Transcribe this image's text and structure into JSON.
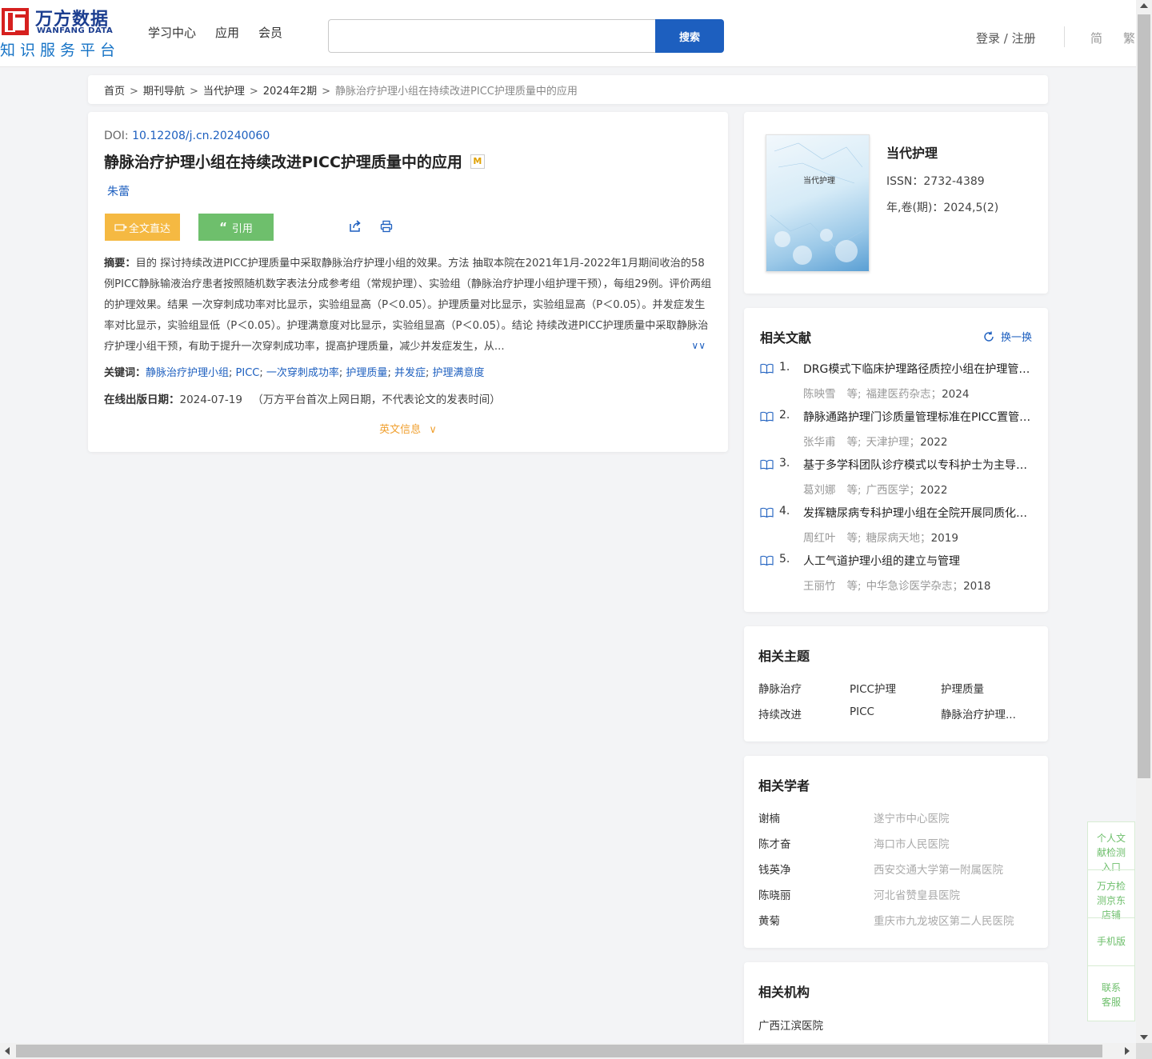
{
  "header": {
    "logo_cn": "万方数据",
    "logo_en": "WANFANG DATA",
    "logo_sub": "知识服务平台",
    "nav": [
      "学习中心",
      "应用",
      "会员"
    ],
    "search_placeholder": "",
    "search_button": "搜索",
    "login": "登录 / 注册",
    "lang_simplified": "简",
    "lang_traditional": "繁"
  },
  "breadcrumb": [
    "首页",
    "期刊导航",
    "当代护理",
    "2024年2期",
    "静脉治疗护理小组在持续改进PICC护理质量中的应用"
  ],
  "article": {
    "doi_label": "DOI:",
    "doi": "10.12208/j.cn.20240060",
    "title": "静脉治疗护理小组在持续改进PICC护理质量中的应用",
    "title_badge": "M",
    "author": "朱蕾",
    "btn_fulltext": "全文直达",
    "btn_cite": "引用",
    "abstract_label": "摘要：",
    "abstract": "目的 探讨持续改进PICC护理质量中采取静脉治疗护理小组的效果。方法 抽取本院在2021年1月-2022年1月期间收治的58例PICC静脉输液治疗患者按照随机数字表法分成参考组（常规护理）、实验组（静脉治疗护理小组护理干预），每组29例。评价两组的护理效果。结果 一次穿刺成功率对比显示，实验组显高（P＜0.05）。护理质量对比显示，实验组显高（P＜0.05）。并发症发生率对比显示，实验组显低（P＜0.05）。护理满意度对比显示，实验组显高（P＜0.05）。结论 持续改进PICC护理质量中采取静脉治疗护理小组干预，有助于提升一次穿刺成功率，提高护理质量，减少并发症发生，从...",
    "keywords_label": "关键词：",
    "keywords": [
      "静脉治疗护理小组",
      "PICC",
      "一次穿刺成功率",
      "护理质量",
      "并发症",
      "护理满意度"
    ],
    "pubdate_label": "在线出版日期：",
    "pubdate": "2024-07-19",
    "pubdate_note": "（万方平台首次上网日期，不代表论文的发表时间）",
    "english_info": "英文信息"
  },
  "journal": {
    "cover_title": "当代护理",
    "name": "当代护理",
    "issn": "ISSN：2732-4389",
    "volume": "年,卷(期)：2024,5(2)"
  },
  "related_docs": {
    "title": "相关文献",
    "refresh": "换一换",
    "items": [
      {
        "num": "1.",
        "title": "DRG模式下临床护理路径质控小组在护理管理中的应用",
        "author": "陈映雪",
        "etal": "等;",
        "source": "福建医药杂志；",
        "year": "2024"
      },
      {
        "num": "2.",
        "title": "静脉通路护理门诊质量管理标准在PICC置管患者中的应用",
        "author": "张华甫",
        "etal": "等;",
        "source": "天津护理；",
        "year": "2022"
      },
      {
        "num": "3.",
        "title": "基于多学科团队诊疗模式以专科护士为主导的管理实践",
        "author": "葛刘娜",
        "etal": "等;",
        "source": "广西医学；",
        "year": "2022"
      },
      {
        "num": "4.",
        "title": "发挥糖尿病专科护理小组在全院开展同质化护理中的作用",
        "author": "周红叶",
        "etal": "等;",
        "source": "糖尿病天地；",
        "year": "2019"
      },
      {
        "num": "5.",
        "title": "人工气道护理小组的建立与管理",
        "author": "王丽竹",
        "etal": "等;",
        "source": "中华急诊医学杂志；",
        "year": "2018"
      }
    ]
  },
  "related_topics": {
    "title": "相关主题",
    "items": [
      "静脉治疗",
      "PICC护理",
      "护理质量",
      "持续改进",
      "PICC",
      "静脉治疗护理..."
    ]
  },
  "related_scholars": {
    "title": "相关学者",
    "items": [
      {
        "name": "谢楠",
        "org": "遂宁市中心医院"
      },
      {
        "name": "陈才奋",
        "org": "海口市人民医院"
      },
      {
        "name": "钱英净",
        "org": "西安交通大学第一附属医院"
      },
      {
        "name": "陈晓丽",
        "org": "河北省赞皇县医院"
      },
      {
        "name": "黄菊",
        "org": "重庆市九龙坡区第二人民医院"
      }
    ]
  },
  "related_institutions": {
    "title": "相关机构",
    "items": [
      "广西江滨医院"
    ]
  },
  "float_bar": {
    "item1": "个人文献检测入口",
    "item2": "万方检测京东店铺",
    "item3": "手机版",
    "item4": "联系客服"
  },
  "colors": {
    "brand_blue": "#1d5fbf",
    "logo_red": "#d6201f",
    "fulltext_orange": "#f5b942",
    "cite_green": "#6ebf6c"
  }
}
